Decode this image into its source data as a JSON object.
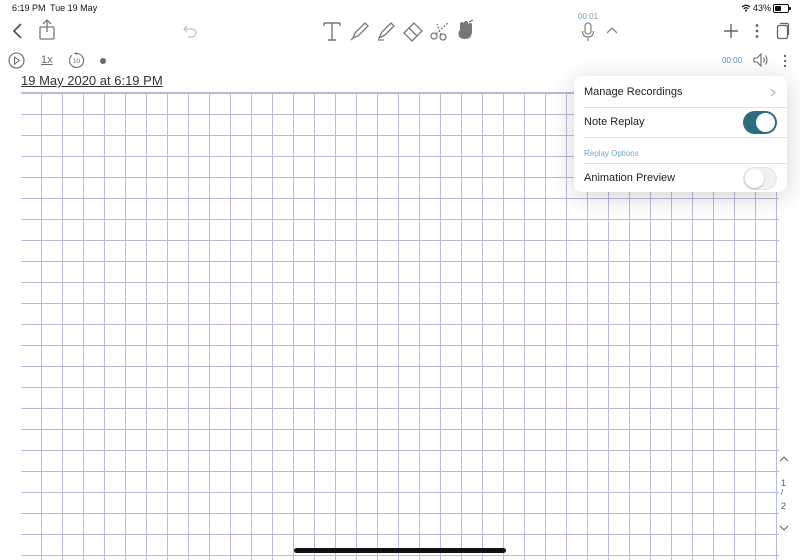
{
  "status_bar": {
    "time": "6:19 PM",
    "date": "Tue 19 May",
    "battery": "43%"
  },
  "toolbar": {
    "icons": [
      "back-icon",
      "share-icon",
      "undo-icon",
      "text-tool-icon",
      "pen-tool-icon",
      "highlighter-tool-icon",
      "eraser-tool-icon",
      "scissors-tool-icon",
      "hand-tool-icon",
      "microphone-icon",
      "chevron-up-icon",
      "add-icon",
      "more-vertical-icon",
      "pages-icon"
    ],
    "mic_timer": "00:01"
  },
  "subbar": {
    "playback_rate": "1x",
    "skip_back_seconds": "10",
    "elapsed": "00:00"
  },
  "note": {
    "title": "19 May 2020 at 6:19 PM"
  },
  "menu": {
    "manage_recordings": "Manage Recordings",
    "note_replay": "Note Replay",
    "note_replay_on": true,
    "section_header": "Replay Options",
    "animation_preview": "Animation Preview",
    "animation_preview_on": false
  },
  "page_nav": {
    "current": "1",
    "separator": "/",
    "total": "2"
  },
  "colors": {
    "accent": "#2e6b7d",
    "section_header": "#6ea7c9",
    "grid": "#b9bcd9"
  }
}
